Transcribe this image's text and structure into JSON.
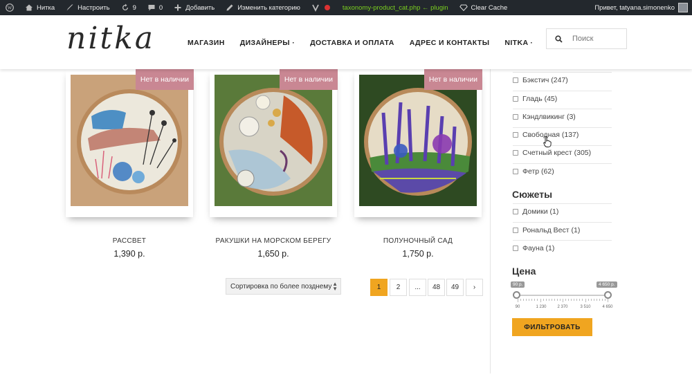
{
  "adminbar": {
    "site_name": "Нитка",
    "customize": "Настроить",
    "updates": "9",
    "comments": "0",
    "add_new": "Добавить",
    "edit_category": "Изменить категорию",
    "template_info": "taxonomy-product_cat.php ← plugin",
    "clear_cache": "Clear Cache",
    "greeting": "Привет, tatyana.simonenko"
  },
  "header": {
    "logo": "nitka",
    "nav": [
      "МАГАЗИН",
      "ДИЗАЙНЕРЫ ·",
      "ДОСТАВКА И ОПЛАТА",
      "АДРЕС И КОНТАКТЫ",
      "NITKA ·"
    ],
    "search_placeholder": "Поиск"
  },
  "products": [
    {
      "title": "РАССВЕТ",
      "price": "1,390 р.",
      "badge": "Нет в наличии"
    },
    {
      "title": "РАКУШКИ НА МОРСКОМ БЕРЕГУ",
      "price": "1,650 р.",
      "badge": "Нет в наличии"
    },
    {
      "title": "ПОЛУНОЧНЫЙ САД",
      "price": "1,750 р.",
      "badge": "Нет в наличии"
    }
  ],
  "sort": {
    "selected": "Сортировка по более позднему"
  },
  "pagination": [
    "1",
    "2",
    "...",
    "48",
    "49",
    "›"
  ],
  "sidebar": {
    "techniques": [
      "Бэкстич (247)",
      "Гладь (45)",
      "Кэндлвикинг (3)",
      "Свободная (137)",
      "Счетный крест (305)",
      "Фетр (62)"
    ],
    "plots_title": "Сюжеты",
    "plots": [
      "Домики (1)",
      "Рональд Вест (1)",
      "Фауна (1)"
    ],
    "price_title": "Цена",
    "price_min_label": "90 р.",
    "price_max_label": "4 650 р.",
    "ticks": [
      "90",
      "1 230",
      "2 370",
      "3 510",
      "4 650"
    ],
    "filter_button": "ФИЛЬТРОВАТЬ"
  },
  "colors": {
    "accent": "#f0a520",
    "badge": "#c98793",
    "adminbar": "#23282d"
  }
}
